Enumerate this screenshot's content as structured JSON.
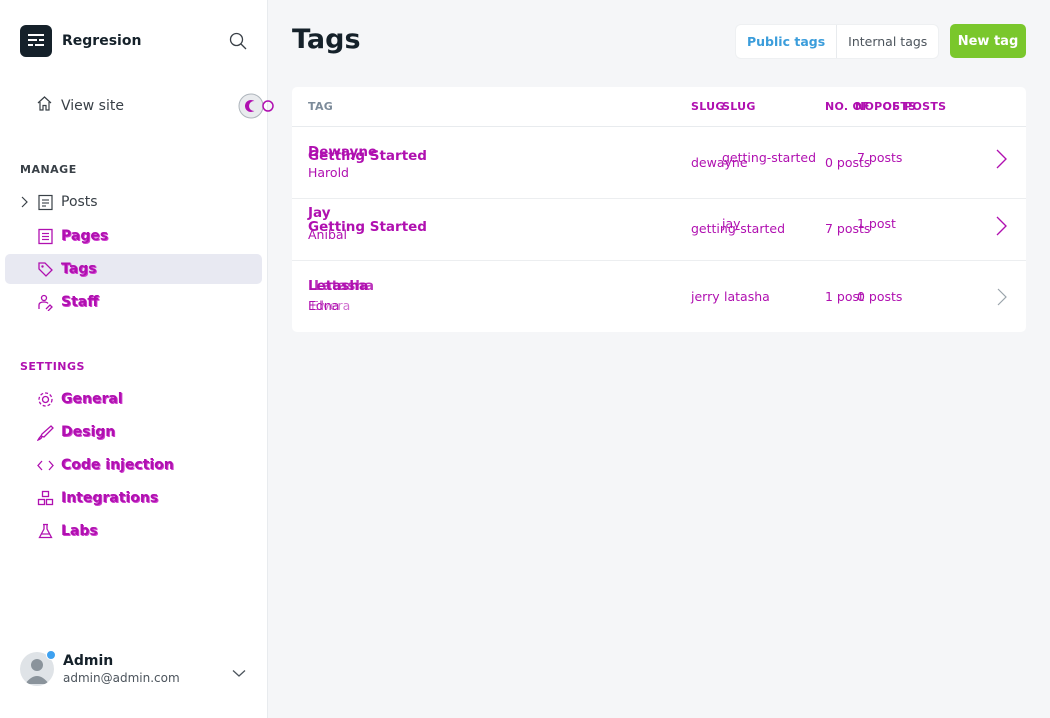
{
  "app": {
    "name": "Regresion"
  },
  "sidebar": {
    "view_site": "View site",
    "manage_label": "MANAGE",
    "settings_label": "SETTINGS",
    "manage_items": [
      {
        "label": "Posts",
        "icon": "posts-icon"
      },
      {
        "label": "Pages",
        "icon": "pages-icon"
      },
      {
        "label": "Tags",
        "icon": "tag-icon"
      },
      {
        "label": "Staff",
        "icon": "staff-icon"
      }
    ],
    "settings_items": [
      {
        "label": "General",
        "icon": "gear-icon"
      },
      {
        "label": "Design",
        "icon": "brush-icon"
      },
      {
        "label": "Code injection",
        "icon": "code-icon"
      },
      {
        "label": "Integrations",
        "icon": "integrations-icon"
      },
      {
        "label": "Labs",
        "icon": "flask-icon"
      }
    ],
    "user": {
      "name": "Admin",
      "email": "admin@admin.com"
    }
  },
  "main": {
    "title": "Tags",
    "tabs": {
      "public": "Public tags",
      "internal": "Internal tags"
    },
    "new_tag": "New tag",
    "table": {
      "headers": {
        "tag": "TAG",
        "slug_a": "SLUG",
        "slug_b": "SLUG",
        "count_a": "NO. OF POSTS",
        "count_b": "NO. OF POSTS"
      },
      "rows": [
        {
          "name_a": "Dewayne",
          "name_b": "Getting Started",
          "desc": "Harold",
          "slug_a": "dewayne",
          "slug_b": "getting-started",
          "count_a": "0 posts",
          "count_b": "7 posts"
        },
        {
          "name_a": "Jay",
          "name_b": "Getting Started",
          "desc": "Anibal",
          "slug_a": "getting-started",
          "slug_b": "jay",
          "count_a": "7 posts",
          "count_b": "1 post"
        },
        {
          "name_a": "Letasha",
          "name_b": "Latasha",
          "desc": "Edna",
          "desc_b": "Elvera",
          "slug_a": "jerry",
          "slug_b": "latasha",
          "count_a": "1 post",
          "count_b": "0 posts"
        }
      ]
    }
  },
  "colors": {
    "accent_green": "#7ac72c",
    "tab_blue": "#3b9ddb",
    "magenta": "#b010b0",
    "dark": "#15212a"
  }
}
